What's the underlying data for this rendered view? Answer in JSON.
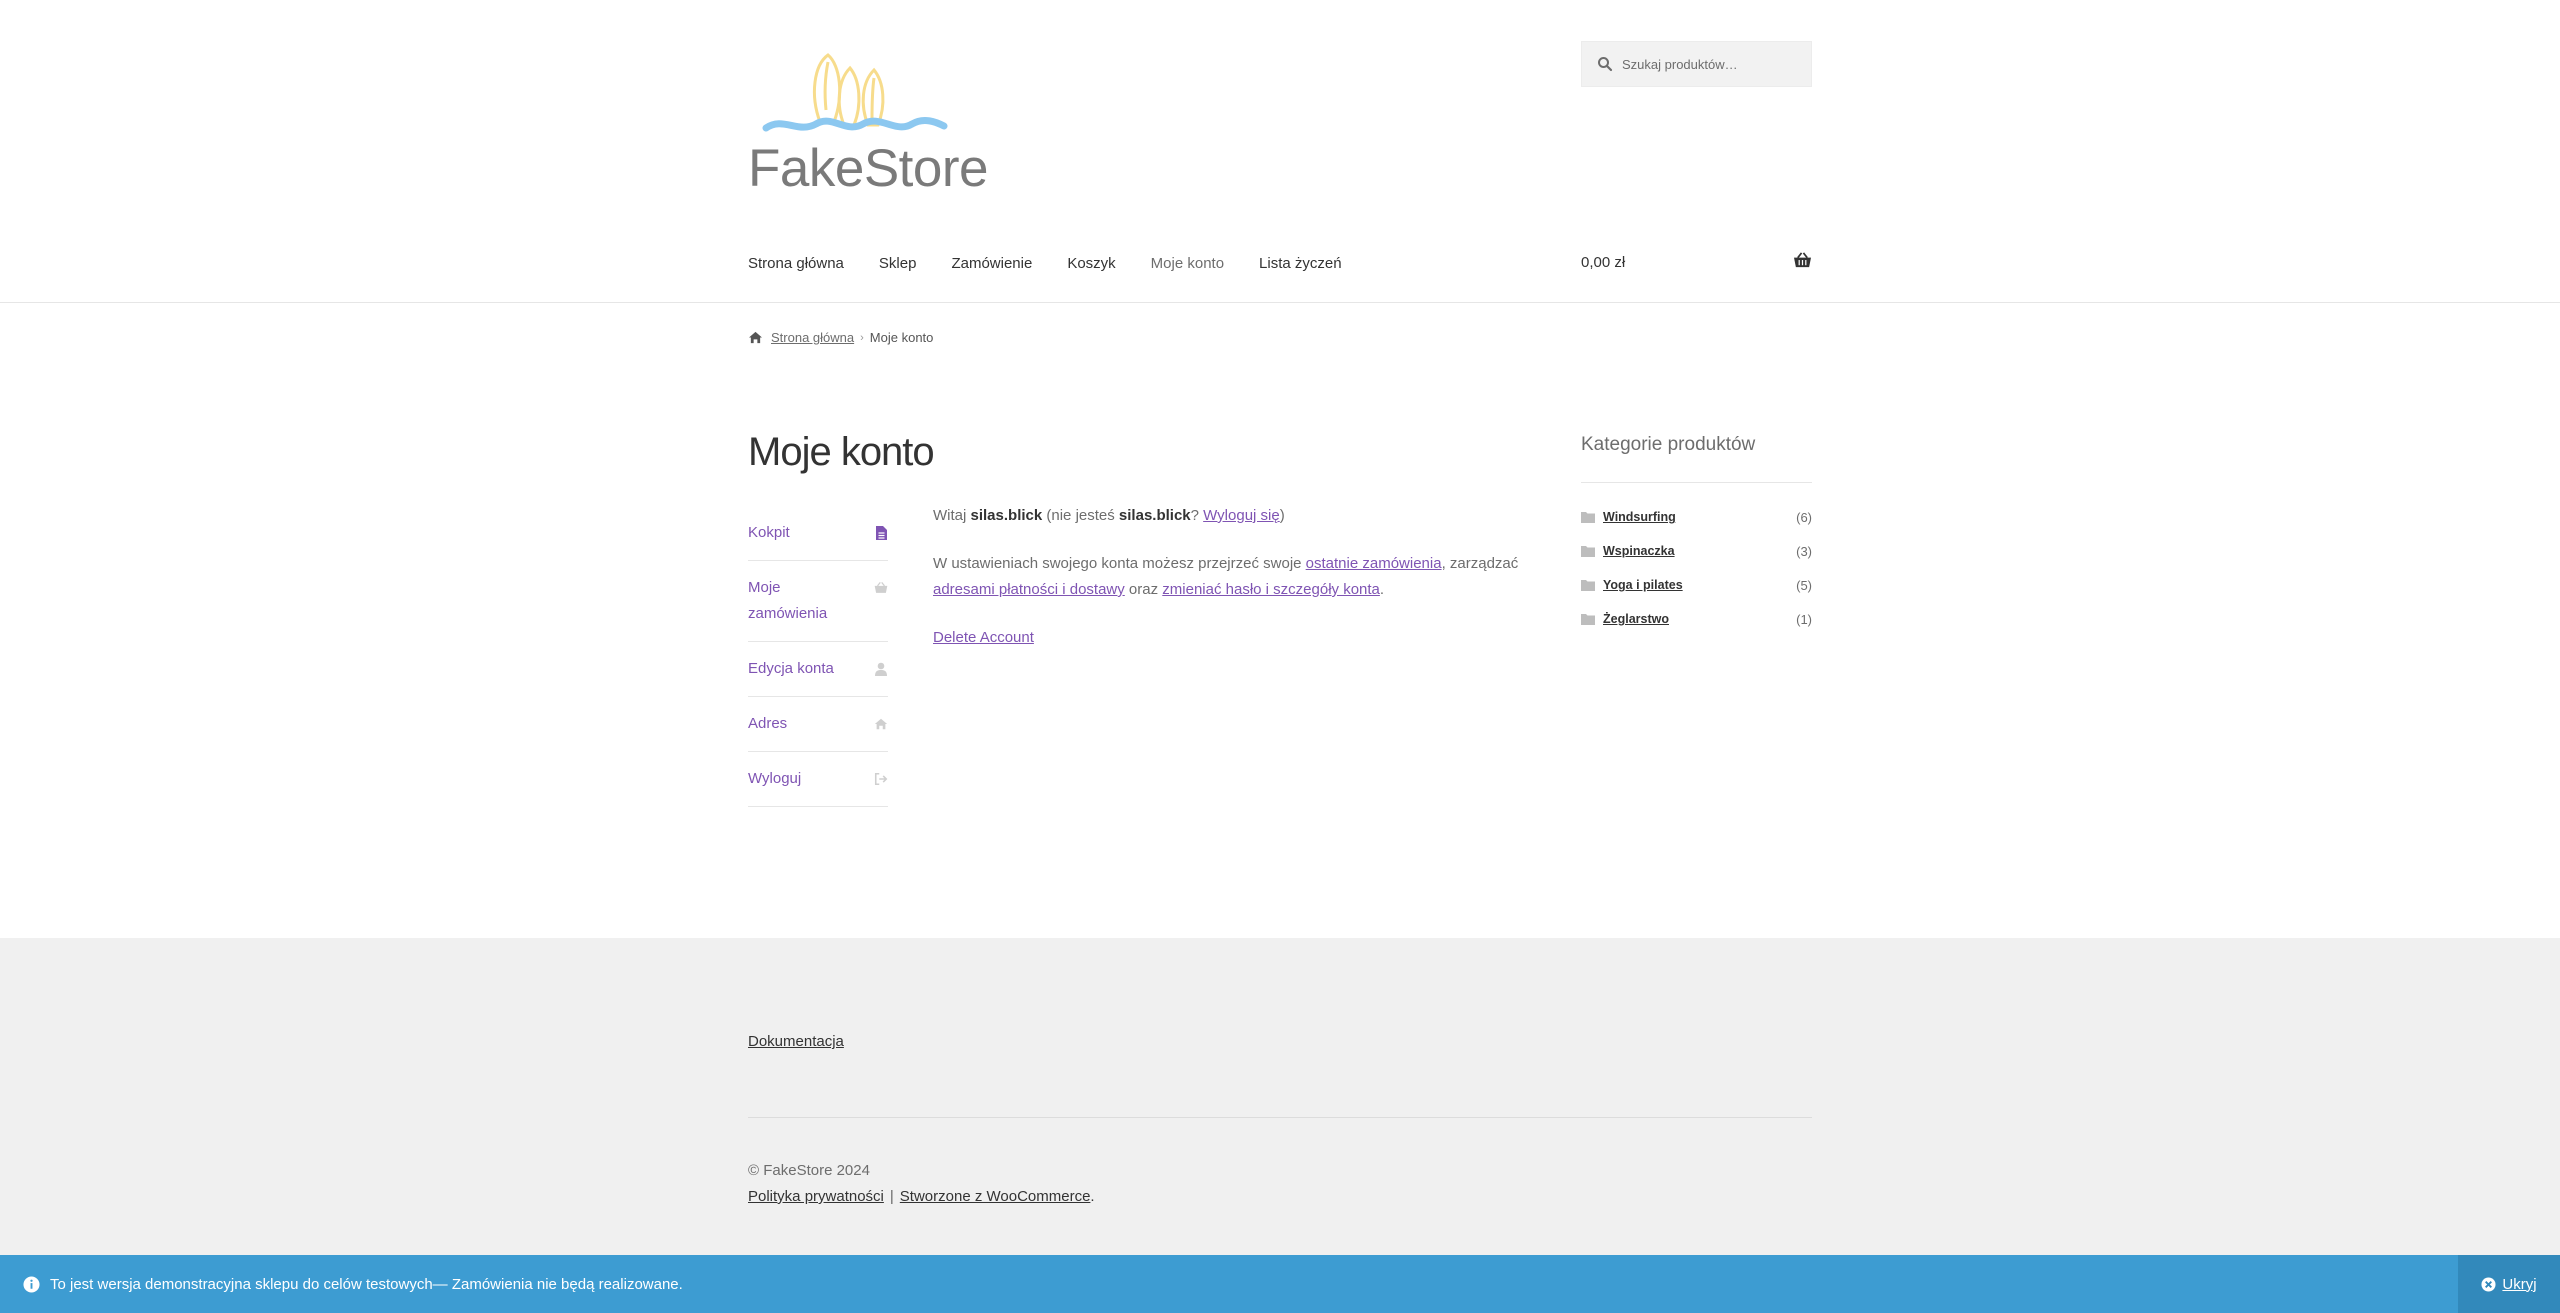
{
  "header": {
    "logo_text": "FakeStore",
    "search": {
      "placeholder": "Szukaj produktów…"
    },
    "nav": [
      "Strona główna",
      "Sklep",
      "Zamówienie",
      "Koszyk",
      "Moje konto",
      "Lista życzeń"
    ],
    "active_nav": "Moje konto",
    "cart_total": "0,00 zł"
  },
  "breadcrumb": {
    "home": "Strona główna",
    "sep": "›",
    "current": "Moje konto"
  },
  "page": {
    "title": "Moje konto"
  },
  "account_nav": [
    {
      "label": "Kokpit",
      "icon": "file-icon"
    },
    {
      "label": "Moje zamówienia",
      "icon": "basket-icon"
    },
    {
      "label": "Edycja konta",
      "icon": "user-icon"
    },
    {
      "label": "Adres",
      "icon": "home-icon"
    },
    {
      "label": "Wyloguj",
      "icon": "sign-out-icon"
    }
  ],
  "content": {
    "greet_prefix": "Witaj ",
    "username": "silas.blick",
    "greet_mid": " (nie jesteś ",
    "greet_q": "? ",
    "logout_link": "Wyloguj się",
    "greet_end": ")",
    "desc_prefix": "W ustawieniach swojego konta możesz przejrzeć swoje ",
    "orders_link": "ostatnie zamówienia",
    "desc_mid1": ", zarządzać ",
    "addresses_link": "adresami płatności i dostawy",
    "desc_mid2": " oraz ",
    "details_link": "zmieniać hasło i szczegóły konta",
    "desc_end": ".",
    "delete_account": "Delete Account"
  },
  "sidebar": {
    "title": "Kategorie produktów",
    "categories": [
      {
        "name": "Windsurfing",
        "count": "(6)"
      },
      {
        "name": "Wspinaczka",
        "count": "(3)"
      },
      {
        "name": "Yoga i pilates",
        "count": "(5)"
      },
      {
        "name": "Żeglarstwo",
        "count": "(1)"
      }
    ]
  },
  "footer": {
    "doc_link": "Dokumentacja",
    "copyright": "© FakeStore 2024",
    "privacy": "Polityka prywatności",
    "pipe": "|",
    "woo": "Stworzone z WooCommerce",
    "woo_end": "."
  },
  "notice": {
    "text": "To jest wersja demonstracyjna sklepu do celów testowych— Zamówienia nie będą realizowane.",
    "dismiss": "Ukryj"
  },
  "colors": {
    "accent": "#7f54b3",
    "notice_bg": "#3d9cd2",
    "footer_bg": "#f0f0f0"
  }
}
